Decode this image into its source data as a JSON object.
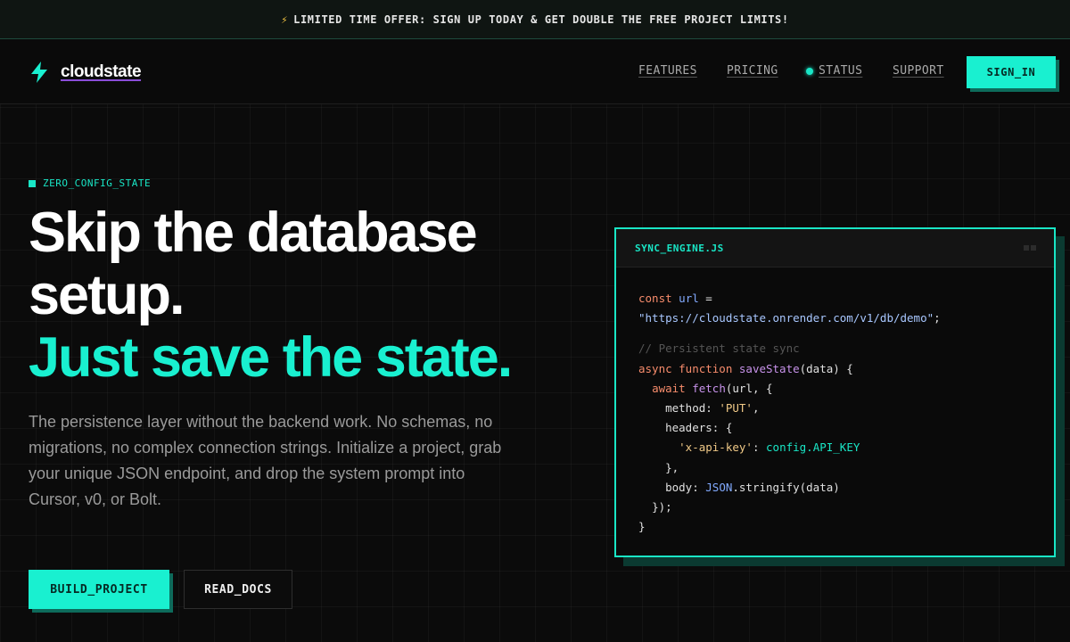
{
  "banner": {
    "icon": "lightning-icon",
    "text": "LIMITED TIME OFFER: SIGN UP TODAY & GET DOUBLE THE FREE PROJECT LIMITS!"
  },
  "header": {
    "logo_icon": "bolt-logo-icon",
    "logo_text": "cloudstate",
    "nav": {
      "features": "FEATURES",
      "pricing": "PRICING",
      "status": "STATUS",
      "support": "SUPPORT"
    },
    "sign_in": "SIGN_IN"
  },
  "hero": {
    "kicker": "ZERO_CONFIG_STATE",
    "headline_line1": "Skip the database",
    "headline_line2": "setup.",
    "headline_accent": "Just save the state.",
    "subtext": "The persistence layer without the backend work. No schemas, no migrations, no complex connection strings. Initialize a project, grab your unique JSON endpoint, and drop the system prompt into Cursor, v0, or Bolt.",
    "primary_button": "BUILD_PROJECT",
    "secondary_button": "READ_DOCS"
  },
  "code_card": {
    "title": "SYNC_ENGINE.JS",
    "lines": {
      "l1_kw": "const",
      "l1_var": "url",
      "l1_op": " =",
      "l2_str": "\"https://cloudstate.onrender.com/v1/db/demo\"",
      "l2_end": ";",
      "l3_comment": "// Persistent state sync",
      "l4_kw": "async function",
      "l4_fn": "saveState",
      "l4_rest": "(data) {",
      "l5_kw": "await",
      "l5_fn": "fetch",
      "l5_rest": "(url, {",
      "l6_key": "method: ",
      "l6_val": "'PUT'",
      "l6_end": ",",
      "l7": "headers: {",
      "l8_key": "'x-api-key'",
      "l8_colon": ": ",
      "l8_val": "config.API_KEY",
      "l9": "},",
      "l10_key": "body: ",
      "l10_obj": "JSON",
      "l10_rest": ".stringify(data)",
      "l11": "});",
      "l12": "}"
    }
  },
  "colors": {
    "accent": "#19f0d0",
    "background": "#0b0b0b",
    "accent_shadow": "#0d6b5b"
  }
}
